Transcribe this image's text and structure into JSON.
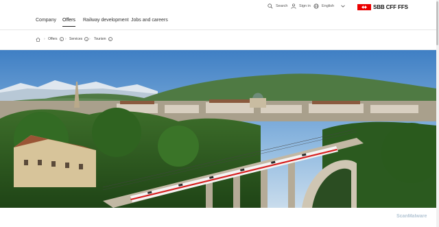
{
  "header": {
    "search_label": "Search",
    "signin_label": "Sign in",
    "language_label": "English",
    "logo_text": "SBB CFF FFS",
    "brand_color": "#eb0000"
  },
  "nav": {
    "items": [
      "Company",
      "Offers",
      "Railway development",
      "Jobs and careers"
    ],
    "active": "Offers"
  },
  "breadcrumb": {
    "items": [
      "Offers",
      "Services",
      "Tourism"
    ]
  },
  "hero": {
    "description_icon": "train-on-bridge-photo"
  },
  "watermark": {
    "text": "ScanMalware"
  }
}
